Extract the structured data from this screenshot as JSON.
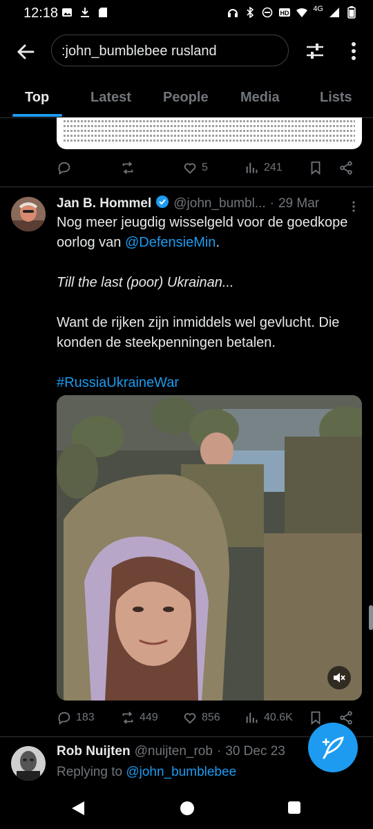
{
  "status_bar": {
    "time": "12:18",
    "network": "4G",
    "left_icons": [
      "gallery-icon",
      "download-icon",
      "sd-card-icon"
    ],
    "right_icons": [
      "headset-icon",
      "bluetooth-icon",
      "do-not-disturb-icon",
      "hd-icon",
      "wifi-icon",
      "signal-icon",
      "battery-icon"
    ]
  },
  "search": {
    "query": ":john_bumblebee rusland"
  },
  "tabs": [
    {
      "label": "Top",
      "active": true
    },
    {
      "label": "Latest",
      "active": false
    },
    {
      "label": "People",
      "active": false
    },
    {
      "label": "Media",
      "active": false
    },
    {
      "label": "Lists",
      "active": false
    }
  ],
  "prev_tweet": {
    "likes": "5",
    "views": "241"
  },
  "tweet": {
    "author_name": "Jan B. Hommel",
    "handle": "@john_bumbl...",
    "separator": "·",
    "date": "29 Mar",
    "line1": "Nog meer jeugdig wisselgeld voor de goedkope oorlog van ",
    "mention": "@DefensieMin",
    "line1_end": ".",
    "line2": "Till the last (poor) Ukrainan...",
    "line3": "Want de rijken zijn inmiddels wel gevlucht. Die konden de steekpenningen betalen.",
    "hashtag": "#RussiaUkraineWar",
    "stats": {
      "replies": "183",
      "reposts": "449",
      "likes": "856",
      "views": "40.6K"
    }
  },
  "tweet2": {
    "author_name": "Rob Nuijten",
    "handle": "@nuijten_rob",
    "separator": "·",
    "date": "30 Dec 23",
    "replying_prefix": "Replying to ",
    "replying_handle": "@john_bumblebee"
  },
  "colors": {
    "accent": "#1d9bf0",
    "muted": "#71767b",
    "background": "#000000",
    "text": "#e7e9ea"
  }
}
